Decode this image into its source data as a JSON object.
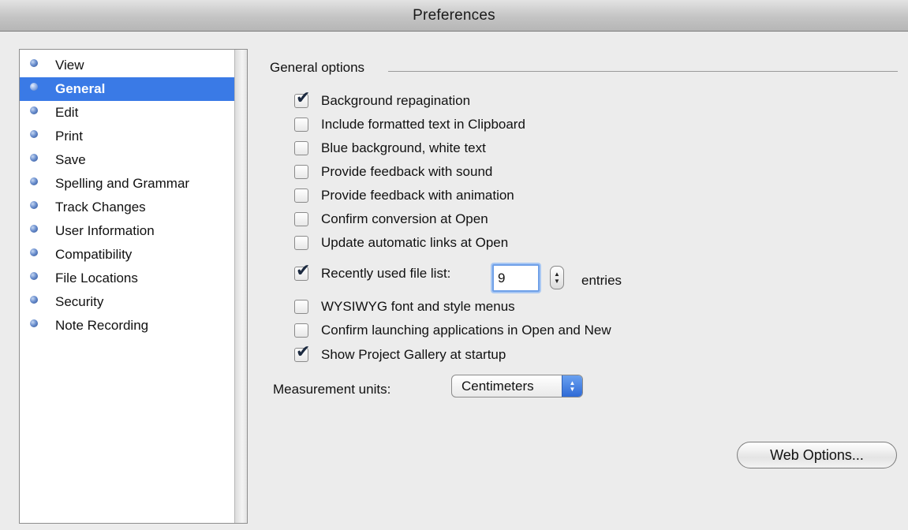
{
  "window": {
    "title": "Preferences"
  },
  "sidebar": {
    "items": [
      {
        "label": "View",
        "selected": false
      },
      {
        "label": "General",
        "selected": true
      },
      {
        "label": "Edit",
        "selected": false
      },
      {
        "label": "Print",
        "selected": false
      },
      {
        "label": "Save",
        "selected": false
      },
      {
        "label": "Spelling and Grammar",
        "selected": false
      },
      {
        "label": "Track Changes",
        "selected": false
      },
      {
        "label": "User Information",
        "selected": false
      },
      {
        "label": "Compatibility",
        "selected": false
      },
      {
        "label": "File Locations",
        "selected": false
      },
      {
        "label": "Security",
        "selected": false
      },
      {
        "label": "Note Recording",
        "selected": false
      }
    ]
  },
  "general": {
    "group_title": "General options",
    "options": [
      {
        "label": "Background repagination",
        "checked": true
      },
      {
        "label": "Include formatted text in Clipboard",
        "checked": false
      },
      {
        "label": "Blue background, white text",
        "checked": false
      },
      {
        "label": "Provide feedback with sound",
        "checked": false
      },
      {
        "label": "Provide feedback with animation",
        "checked": false
      },
      {
        "label": "Confirm conversion at Open",
        "checked": false
      },
      {
        "label": "Update automatic links at Open",
        "checked": false
      },
      {
        "label": "Recently used file list:",
        "checked": true
      },
      {
        "label": "WYSIWYG font and style menus",
        "checked": false
      },
      {
        "label": "Confirm launching applications in Open and New",
        "checked": false
      },
      {
        "label": "Show Project Gallery at startup",
        "checked": true
      }
    ],
    "recent_files": {
      "value": "9",
      "suffix": "entries"
    },
    "measurement": {
      "label": "Measurement units:",
      "value": "Centimeters"
    },
    "web_options_button": "Web Options..."
  },
  "colors": {
    "selection": "#3a7ae6",
    "window_bg": "#ececec",
    "focus_ring": "#6fa0e8"
  },
  "icons": {
    "sidebar_bullet": "blue-bullet-icon",
    "checkmark": "checkmark-icon",
    "stepper": "stepper-arrows-icon",
    "select_arrows": "select-arrows-icon"
  }
}
